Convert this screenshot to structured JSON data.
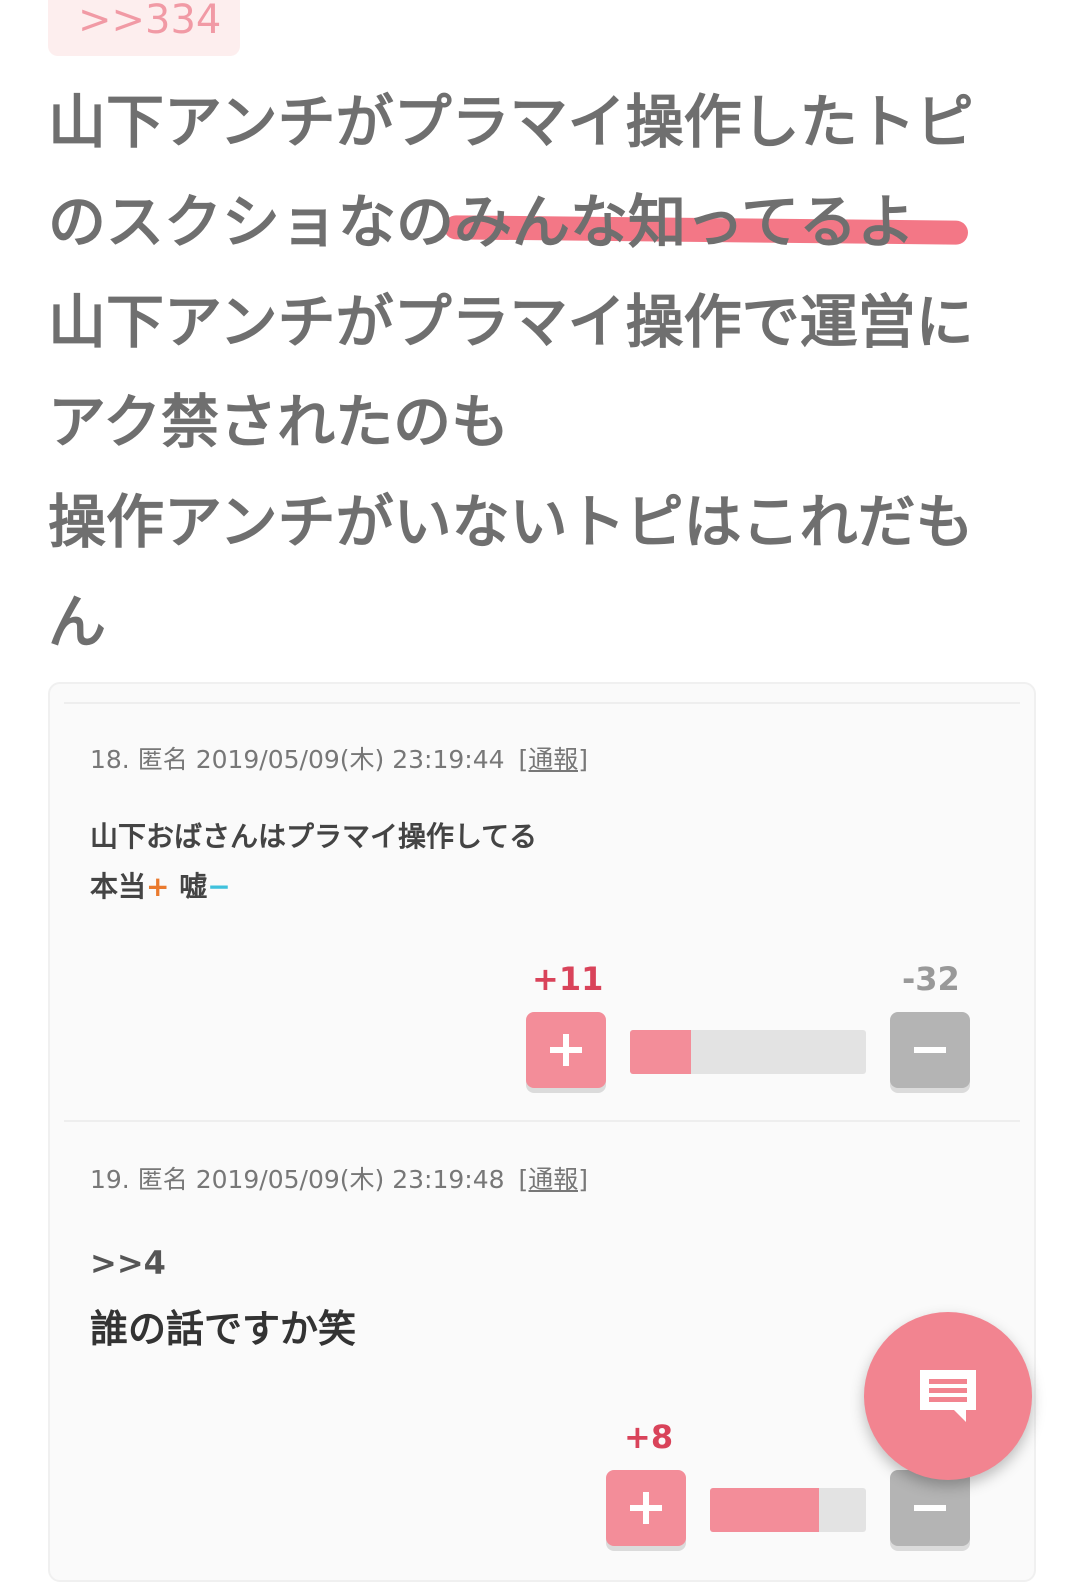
{
  "quote_anchor": ">>334",
  "post_lines": [
    "山下アンチがプラマイ操作したトピ",
    "のスクショなのみんな知ってるよ",
    "山下アンチがプラマイ操作で運営に",
    "アク禁されたのも",
    "操作アンチがいないトピはこれだも",
    "ん"
  ],
  "comments": [
    {
      "number": "18.",
      "author": "匿名",
      "datetime": "2019/05/09(木) 23:19:44",
      "report_label": "[通報]",
      "body_line1": "山下おばさんはプラマイ操作してる",
      "body_true": "本当",
      "body_plus_mark": "+",
      "body_false": "嘘",
      "body_minus_mark": "−",
      "plus_count": "+11",
      "minus_count": "-32",
      "plus_ratio": 0.26
    },
    {
      "number": "19.",
      "author": "匿名",
      "datetime": "2019/05/09(木) 23:19:48",
      "report_label": "[通報]",
      "anchor": ">>4",
      "body": "誰の話ですか笑",
      "plus_count": "+8",
      "plus_ratio": 0.7
    }
  ],
  "fab_icon": "comment-icon",
  "colors": {
    "accent_pink": "#f38d99",
    "plus_red": "#d9435a",
    "underline": "#f26b7c",
    "minus_gray": "#b4b4b4"
  }
}
